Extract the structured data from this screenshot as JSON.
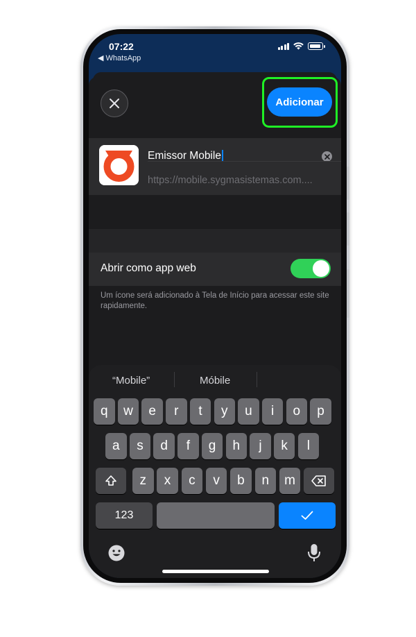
{
  "status_bar": {
    "time": "07:22",
    "back_app": "◀ WhatsApp"
  },
  "header": {
    "close_icon": "close-icon",
    "add_label": "Adicionar"
  },
  "bookmark": {
    "name": "Emissor Mobile",
    "url": "https://mobile.sygmasistemas.com...."
  },
  "web_app_toggle": {
    "label": "Abrir como app web",
    "enabled": true
  },
  "footnote": "Um ícone será adicionado à Tela de Início para acessar este site rapidamente.",
  "keyboard": {
    "predictions": [
      "“Mobile”",
      "Móbile",
      ""
    ],
    "row1": [
      "q",
      "w",
      "e",
      "r",
      "t",
      "y",
      "u",
      "i",
      "o",
      "p"
    ],
    "row2": [
      "a",
      "s",
      "d",
      "f",
      "g",
      "h",
      "j",
      "k",
      "l"
    ],
    "row3": [
      "z",
      "x",
      "c",
      "v",
      "b",
      "n",
      "m"
    ],
    "numbers_label": "123",
    "return_icon": "checkmark-icon",
    "emoji_icon": "emoji-icon",
    "mic_icon": "microphone-icon",
    "shift_icon": "shift-icon",
    "delete_icon": "delete-icon"
  },
  "colors": {
    "accent_blue": "#0a84ff",
    "highlight_green": "#1ff025",
    "toggle_green": "#30d158",
    "brand_red": "#ee4a23"
  }
}
